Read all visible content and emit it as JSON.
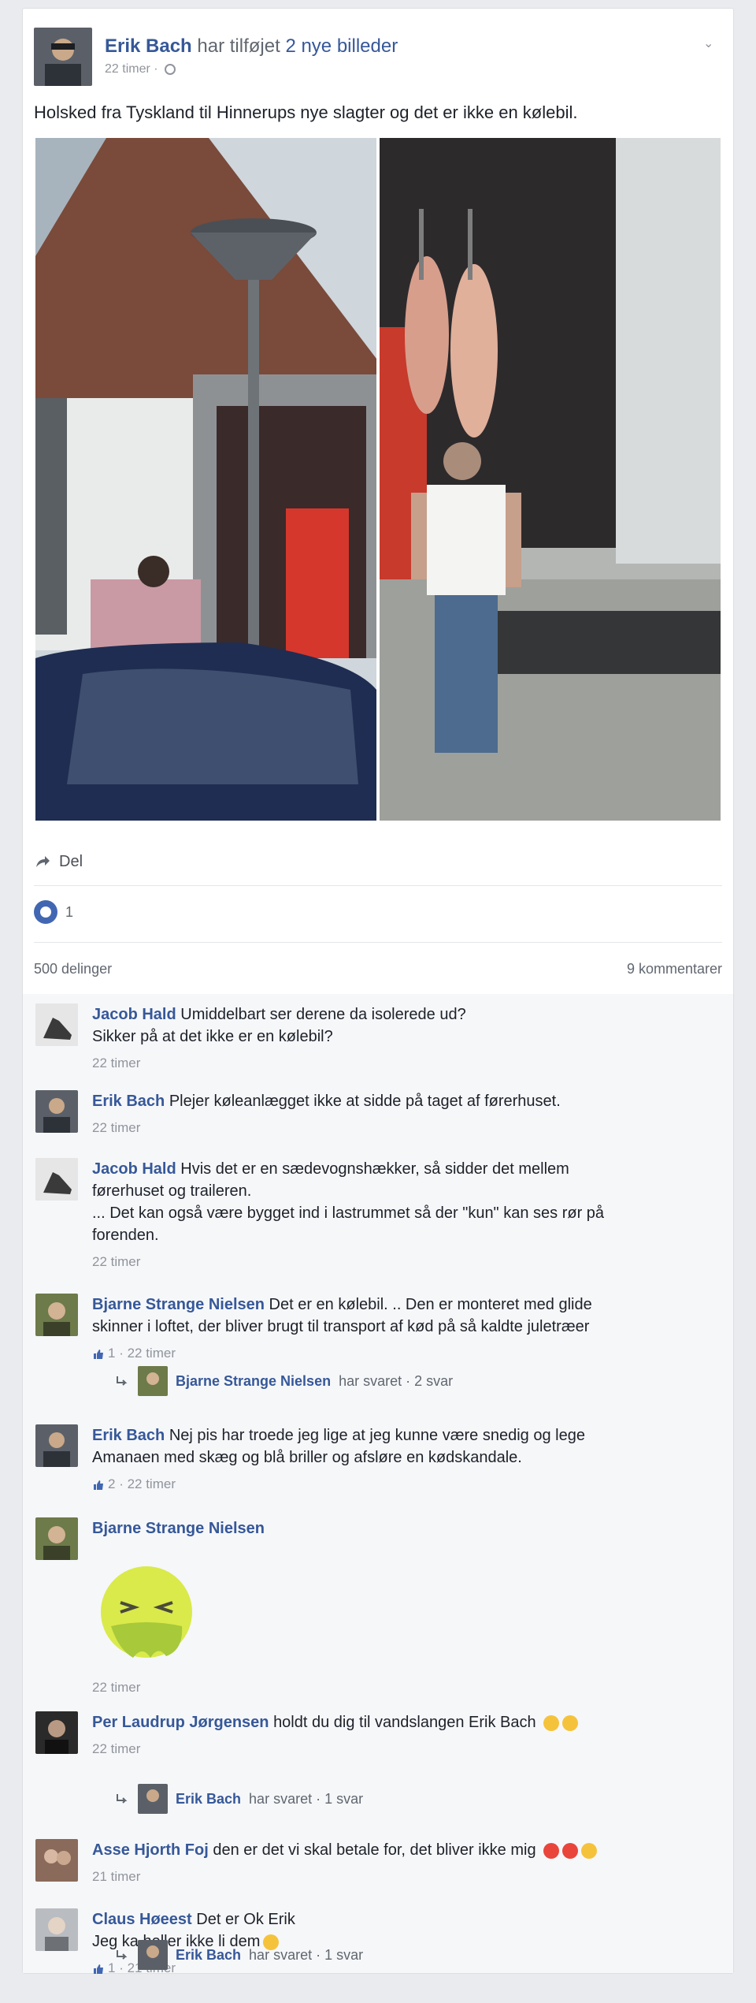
{
  "post": {
    "author": "Erik Bach",
    "action": "har tilføjet",
    "action_link": "2 nye billeder",
    "time": "22 timer",
    "caption": "Holsked fra Tyskland til Hinnerups nye slagter og det er ikke en kølebil."
  },
  "actions": {
    "share_label": "Del"
  },
  "reactions": {
    "count": "1"
  },
  "stats": {
    "shares": "500 delinger",
    "comments": "9 kommentarer"
  },
  "comments": [
    {
      "author": "Jacob Hald",
      "lines": [
        "Umiddelbart ser derene da isolerede ud?",
        "Sikker på at det ikke er en kølebil?"
      ],
      "time": "22 timer"
    },
    {
      "author": "Erik Bach",
      "lines": [
        "Plejer køleanlægget ikke at sidde på taget af førerhuset."
      ],
      "time": "22 timer"
    },
    {
      "author": "Jacob Hald",
      "lines": [
        "Hvis det er en sædevognshækker, så sidder det mellem",
        "førerhuset og traileren.",
        "... Det kan også være bygget ind i lastrummet så der \"kun\" kan ses rør på",
        "forenden."
      ],
      "time": "22 timer"
    },
    {
      "author": "Bjarne Strange Nielsen",
      "lines": [
        "Det er en kølebil. .. Den er monteret med glide",
        "skinner i loftet, der bliver brugt til transport af kød på så kaldte juletræer"
      ],
      "likes": "1",
      "time": "22 timer",
      "reply": {
        "author": "Bjarne Strange Nielsen",
        "text": "har svaret · 2 svar"
      }
    },
    {
      "author": "Erik Bach",
      "lines": [
        "Nej pis har troede jeg lige at jeg kunne være snedig og lege",
        "Amanaen med skæg og blå briller og afsløre en kødskandale."
      ],
      "likes": "2",
      "time": "22 timer"
    },
    {
      "author": "Bjarne Strange Nielsen",
      "lines": [],
      "time": "22 timer",
      "sticker": "nauseated-face-sticker"
    },
    {
      "author": "Per Laudrup Jørgensen",
      "lines": [
        "holdt du dig til vandslangen Erik Bach"
      ],
      "time": "22 timer",
      "reply": {
        "author": "Erik Bach",
        "text": "har svaret · 1 svar"
      }
    },
    {
      "author": "Asse Hjorth Foj",
      "lines": [
        "den er det vi skal betale for, det bliver ikke mig"
      ],
      "time": "21 timer"
    },
    {
      "author": "Claus Høeest",
      "lines": [
        "Det er Ok Erik",
        "Jeg ka heller ikke li dem"
      ],
      "likes": "1",
      "time": "21 timer",
      "reply": {
        "author": "Erik Bach",
        "text": "har svaret · 1 svar"
      }
    }
  ],
  "colors": {
    "link": "#365899",
    "meta": "#90949c",
    "brand": "#4267b2",
    "comments_bg": "#f6f7f9"
  },
  "icons": [
    "globe-icon",
    "chevron-down-icon",
    "share-icon",
    "like-icon",
    "reply-arrow-icon"
  ]
}
